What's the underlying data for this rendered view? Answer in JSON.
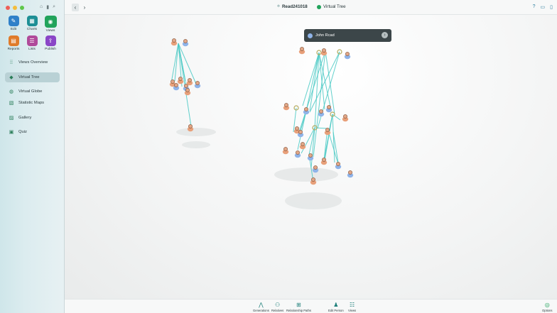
{
  "app": {
    "document_title": "Read241018",
    "view_title": "Virtual Tree"
  },
  "sidebar": {
    "buttons": [
      {
        "label": "Edit",
        "icon": "pencil-icon",
        "glyph": "✎"
      },
      {
        "label": "Charts",
        "icon": "charts-icon",
        "glyph": "▦"
      },
      {
        "label": "Views",
        "icon": "eye-icon",
        "glyph": "◉"
      },
      {
        "label": "Reports",
        "icon": "reports-icon",
        "glyph": "▤"
      },
      {
        "label": "Lists",
        "icon": "list-icon",
        "glyph": "☰"
      },
      {
        "label": "Publish",
        "icon": "upload-icon",
        "glyph": "⇪"
      }
    ],
    "nav": [
      {
        "label": "Views Overview",
        "icon": "grid-dots-icon",
        "glyph": "⁞⁞"
      },
      {
        "label": "Virtual Tree",
        "icon": "cube-icon",
        "glyph": "◆"
      },
      {
        "label": "Virtual Globe",
        "icon": "globe-icon",
        "glyph": "◍"
      },
      {
        "label": "Statistic Maps",
        "icon": "map-icon",
        "glyph": "▧"
      },
      {
        "label": "Gallery",
        "icon": "photo-icon",
        "glyph": "▨"
      },
      {
        "label": "Quiz",
        "icon": "quiz-icon",
        "glyph": "▣"
      }
    ]
  },
  "tooltip": {
    "name": "John Rcad"
  },
  "bottom_toolbar": [
    {
      "label": "Generations",
      "icon": "generations-icon",
      "glyph": "⋀"
    },
    {
      "label": "Relatives",
      "icon": "relatives-icon",
      "glyph": "⚇"
    },
    {
      "label": "Relationship Paths",
      "icon": "paths-icon",
      "glyph": "⊞"
    },
    {
      "label": "Edit Person",
      "icon": "person-icon",
      "glyph": "♟"
    },
    {
      "label": "Views",
      "icon": "views-list-icon",
      "glyph": "☷"
    },
    {
      "label": "Options",
      "icon": "options-icon",
      "glyph": "◎"
    }
  ],
  "colors": {
    "accent": "#21a35b",
    "line": "#48c9c4",
    "male": "#8fb3e8",
    "female": "#e8a07a"
  }
}
